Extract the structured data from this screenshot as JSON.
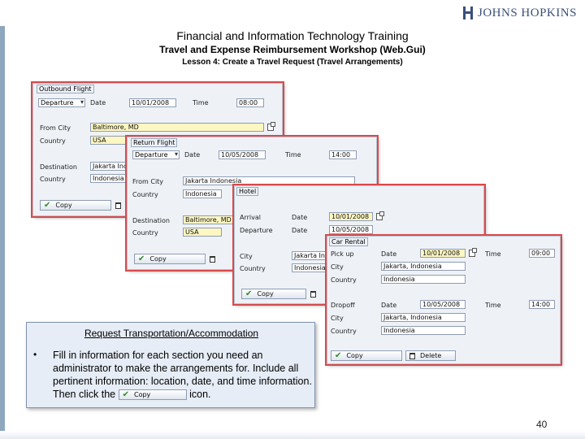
{
  "header": {
    "logo_text": "JOHNS HOPKINS",
    "title_line1": "Financial and Information Technology Training",
    "title_line2": "Travel and Expense Reimbursement Workshop (Web.Gui)",
    "title_line3": "Lesson 4: Create a Travel Request (Travel Arrangements)"
  },
  "outbound": {
    "group_label": "Outbound Flight",
    "departure_select": "Departure",
    "date_label": "Date",
    "date_value": "10/01/2008",
    "time_label": "Time",
    "time_value": "08:00",
    "from_city_label": "From City",
    "from_city_value": "Baltimore, MD",
    "country_label": "Country",
    "country_value": "USA",
    "destination_label": "Destination",
    "destination_value": "Jakarta Ind",
    "country2_label": "Country",
    "country2_value": "Indonesia",
    "copy_label": "Copy"
  },
  "return": {
    "group_label": "Return Flight",
    "departure_select": "Departure",
    "date_label": "Date",
    "date_value": "10/05/2008",
    "time_label": "Time",
    "time_value": "14:00",
    "from_city_label": "From City",
    "from_city_value": "Jakarta Indonesia",
    "country_label": "Country",
    "country_value": "Indonesia",
    "destination_label": "Destination",
    "destination_value": "Baltimore, MD",
    "country2_label": "Country",
    "country2_value": "USA",
    "copy_label": "Copy"
  },
  "hotel": {
    "group_label": "Hotel",
    "arrival_label": "Arrival",
    "arrival_date_label": "Date",
    "arrival_date_value": "10/01/2008",
    "departure_label": "Departure",
    "departure_date_label": "Date",
    "departure_date_value": "10/05/2008",
    "city_label": "City",
    "city_value": "Jakarta Ind",
    "country_label": "Country",
    "country_value": "Indonesia",
    "copy_label": "Copy"
  },
  "car": {
    "group_label": "Car Rental",
    "pickup_label": "Pick up",
    "pickup_date_label": "Date",
    "pickup_date_value": "10/01/2008",
    "pickup_time_label": "Time",
    "pickup_time_value": "09:00",
    "city_label": "City",
    "city_value": "Jakarta, Indonesia",
    "country_label": "Country",
    "country_value": "Indonesia",
    "dropoff_label": "Dropoff",
    "dropoff_date_label": "Date",
    "dropoff_date_value": "10/05/2008",
    "dropoff_time_label": "Time",
    "dropoff_time_value": "14:00",
    "city2_label": "City",
    "city2_value": "Jakarta, Indonesia",
    "country2_label": "Country",
    "country2_value": "Indonesia",
    "copy_label": "Copy",
    "delete_label": "Delete"
  },
  "instructions": {
    "heading": "Request Transportation/Accommodation",
    "bullet": "•",
    "text_before": "Fill in information for each section you need an administrator to make the arrangements for. Include all pertinent information: location, date, and time information. Then click the",
    "copy_label": "Copy",
    "text_after": "icon."
  },
  "page_number": "40"
}
